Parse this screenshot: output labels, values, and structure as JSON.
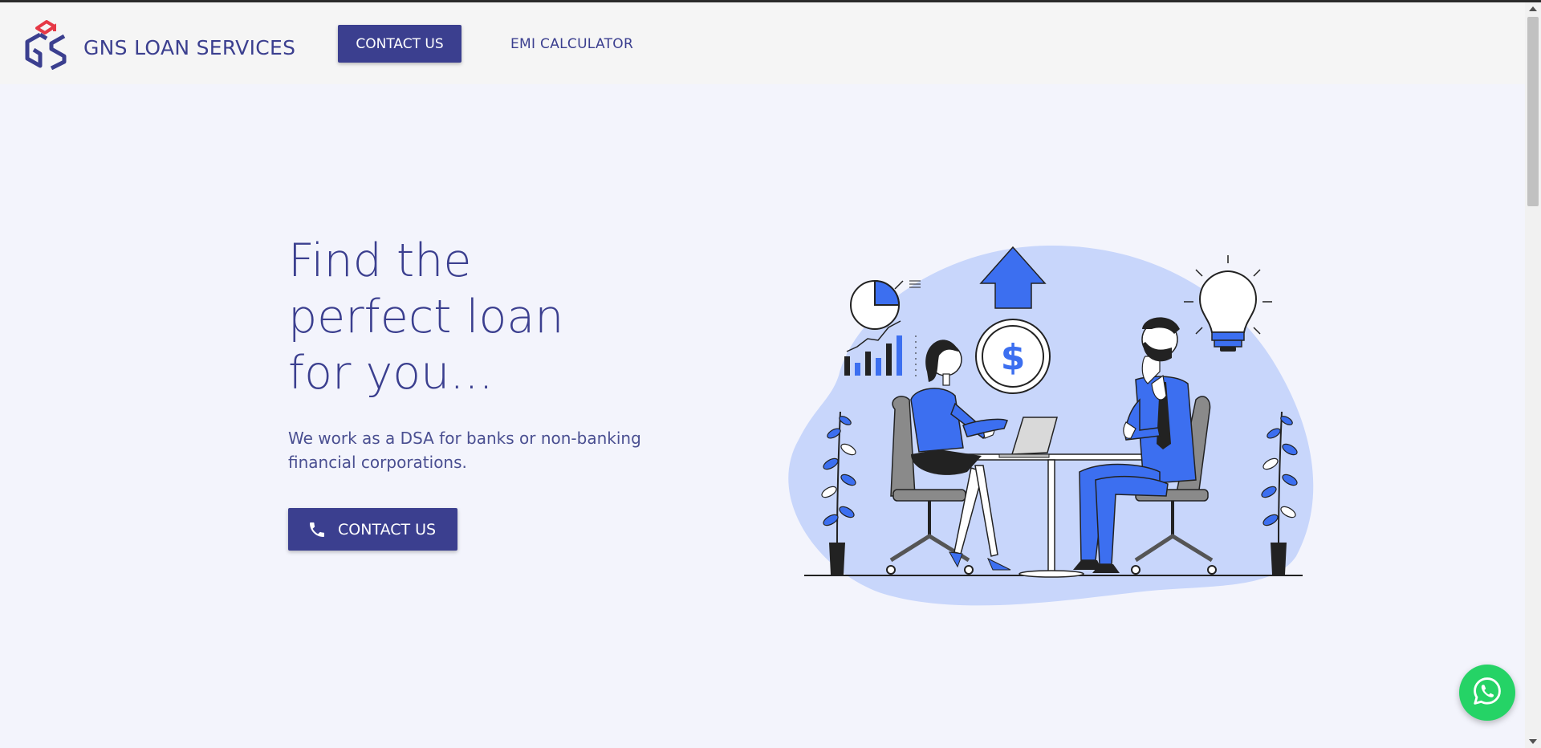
{
  "navbar": {
    "brand": "GNS LOAN SERVICES",
    "contact_label": "CONTACT US",
    "emi_label": "EMI CALCULATOR"
  },
  "hero": {
    "title": "Find the\nperfect loan\nfor you...",
    "subtitle": "We work as a DSA for banks or non-banking financial corporations.",
    "cta_label": "CONTACT US",
    "cta_icon": "phone-icon"
  },
  "floating": {
    "icon": "whatsapp-icon"
  },
  "colors": {
    "brand": "#3b3f8f",
    "accent_blue": "#3c6ff0",
    "blob": "#c8d6fb",
    "whatsapp": "#25d366",
    "logo_red": "#e63946",
    "background": "#f3f4fc"
  }
}
